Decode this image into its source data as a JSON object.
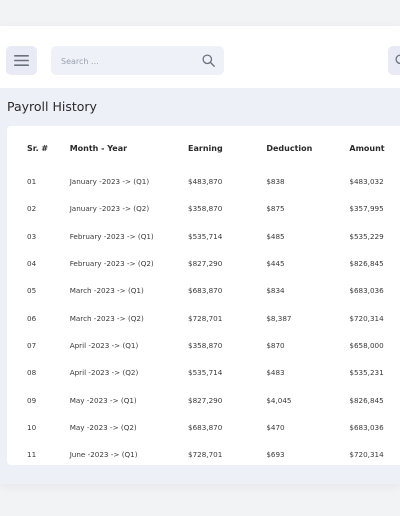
{
  "search": {
    "placeholder": "Search ..."
  },
  "page_title": "Payroll History",
  "table": {
    "headers": [
      "Sr. #",
      "Month - Year",
      "Earning",
      "Deduction",
      "Amount"
    ],
    "rows": [
      [
        "01",
        "January -2023 -> (Q1)",
        "$483,870",
        "$838",
        "$483,032"
      ],
      [
        "02",
        "January -2023 -> (Q2)",
        "$358,870",
        "$875",
        "$357,995"
      ],
      [
        "03",
        "February -2023 -> (Q1)",
        "$535,714",
        "$485",
        "$535,229"
      ],
      [
        "04",
        "February -2023 -> (Q2)",
        "$827,290",
        "$445",
        "$826,845"
      ],
      [
        "05",
        "March -2023 -> (Q1)",
        "$683,870",
        "$834",
        "$683,036"
      ],
      [
        "06",
        "March -2023 -> (Q2)",
        "$728,701",
        "$8,387",
        "$720,314"
      ],
      [
        "07",
        "April -2023 -> (Q1)",
        "$358,870",
        "$870",
        "$658,000"
      ],
      [
        "08",
        "April -2023 -> (Q2)",
        "$535,714",
        "$483",
        "$535,231"
      ],
      [
        "09",
        "May -2023 -> (Q1)",
        "$827,290",
        "$4,045",
        "$826,845"
      ],
      [
        "10",
        "May -2023 -> (Q2)",
        "$683,870",
        "$470",
        "$683,036"
      ],
      [
        "11",
        "June -2023 -> (Q1)",
        "$728,701",
        "$693",
        "$720,314"
      ]
    ]
  },
  "icons": {
    "menu": "hamburger-menu-icon",
    "search": "search-icon",
    "right": "search-icon"
  },
  "colors": {
    "accent_bg": "#e8ebf6",
    "content_bg": "#eef0f8",
    "icon": "#6b7280"
  }
}
